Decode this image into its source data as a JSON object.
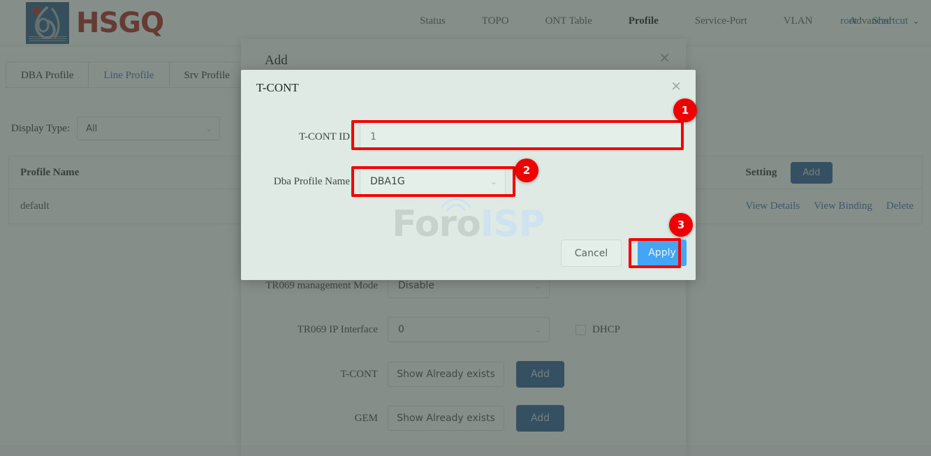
{
  "header": {
    "brand_text": "HSGQ",
    "nav_items": [
      {
        "label": "Status",
        "active": false
      },
      {
        "label": "TOPO",
        "active": false
      },
      {
        "label": "ONT Table",
        "active": false
      },
      {
        "label": "Profile",
        "active": true
      },
      {
        "label": "Service-Port",
        "active": false
      },
      {
        "label": "VLAN",
        "active": false
      },
      {
        "label": "Advanced",
        "active": false
      }
    ],
    "user_label": "root",
    "shortcut_label": "Shortcut",
    "shortcut_caret": "⌄"
  },
  "tabs": [
    {
      "label": "DBA Profile",
      "active": false
    },
    {
      "label": "Line Profile",
      "active": true
    },
    {
      "label": "Srv Profile",
      "active": false
    }
  ],
  "filter": {
    "label": "Display Type:",
    "value": "All",
    "chevron": "⌄"
  },
  "table": {
    "columns": [
      "Profile Name",
      "Setting"
    ],
    "header_add_label": "Add",
    "rows": [
      {
        "profile_name": "default",
        "actions": [
          "View Details",
          "View Binding",
          "Delete"
        ]
      }
    ]
  },
  "add_dialog": {
    "title": "Add",
    "close_glyph": "×",
    "fields": [
      {
        "label": "TR069 management Mode",
        "value": "Disable",
        "type": "select"
      },
      {
        "label": "TR069 IP Interface",
        "value": "0",
        "type": "select",
        "checkbox_label": "DHCP"
      },
      {
        "label": "T-CONT",
        "value": "Show Already exists",
        "type": "button",
        "add_label": "Add"
      },
      {
        "label": "GEM",
        "value": "Show Already exists",
        "type": "button",
        "add_label": "Add"
      }
    ]
  },
  "tcont_dialog": {
    "title": "T-CONT",
    "close_glyph": "×",
    "id_label": "T-CONT ID",
    "id_value": "1",
    "dba_label": "Dba Profile Name",
    "dba_value": "DBA1G",
    "dba_chevron": "⌄",
    "cancel_label": "Cancel",
    "apply_label": "Apply"
  },
  "watermark": {
    "part_a": "Foro",
    "part_b": "ISP"
  },
  "annotations": {
    "badge_1": "1",
    "badge_2": "2",
    "badge_3": "3",
    "color": "#ee0000"
  }
}
